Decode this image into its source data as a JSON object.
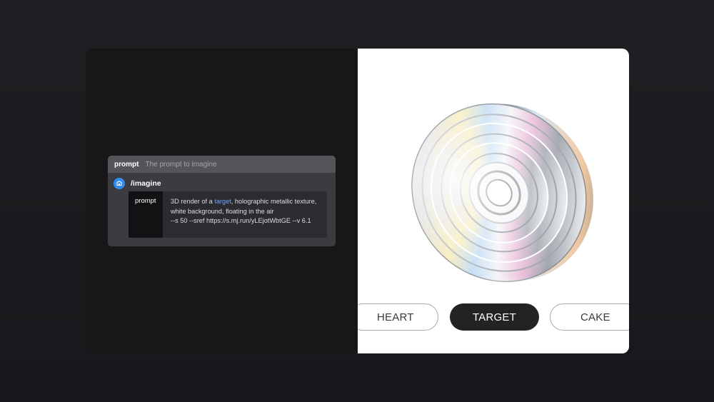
{
  "prompt_panel": {
    "header_label": "prompt",
    "header_description": "The prompt to imagine",
    "command": "/imagine",
    "option_label": "prompt",
    "prompt_before": "3D render of a ",
    "prompt_keyword": "target",
    "prompt_after": ", holographic metallic texture, white background, floating in the air",
    "prompt_params": "--s 50 --sref https://s.mj.run/yLEjotWbtGE --v 6.1"
  },
  "options": {
    "heart_label": "HEART",
    "target_label": "TARGET",
    "cake_label": "CAKE"
  },
  "colors": {
    "accent_icon": "#2f8cf0",
    "keyword": "#6ea7ff",
    "active_pill": "#232323"
  }
}
